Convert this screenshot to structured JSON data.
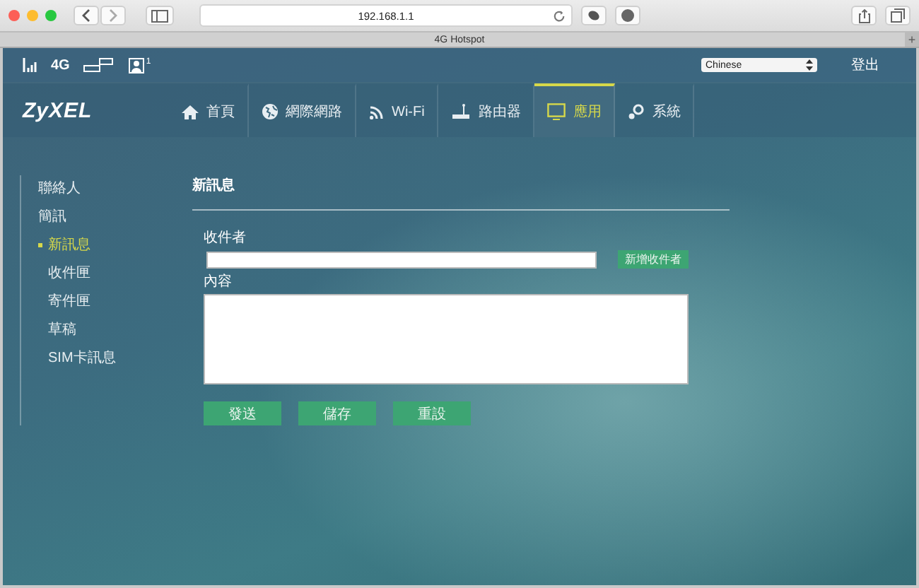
{
  "browser": {
    "url": "192.168.1.1",
    "tab_title": "4G Hotspot",
    "new_tab": "+"
  },
  "status_bar": {
    "network": "4G",
    "user_count": "1",
    "language": "Chinese",
    "logout": "登出"
  },
  "logo": "ZyXEL",
  "nav": [
    {
      "label": "首頁",
      "selected": false
    },
    {
      "label": "網際網路",
      "selected": false
    },
    {
      "label": "Wi-Fi",
      "selected": false
    },
    {
      "label": "路由器",
      "selected": false
    },
    {
      "label": "應用",
      "selected": true
    },
    {
      "label": "系統",
      "selected": false
    }
  ],
  "sidebar": [
    {
      "label": "聯絡人",
      "selected": false
    },
    {
      "label": "簡訊",
      "selected": false,
      "children": [
        {
          "label": "新訊息",
          "selected": true
        },
        {
          "label": "收件匣",
          "selected": false
        },
        {
          "label": "寄件匣",
          "selected": false
        },
        {
          "label": "草稿",
          "selected": false
        },
        {
          "label": "SIM卡訊息",
          "selected": false
        }
      ]
    }
  ],
  "form": {
    "title": "新訊息",
    "recipient_label": "收件者",
    "add_recipient": "新增收件者",
    "content_label": "內容",
    "buttons": [
      "發送",
      "儲存",
      "重設"
    ]
  }
}
